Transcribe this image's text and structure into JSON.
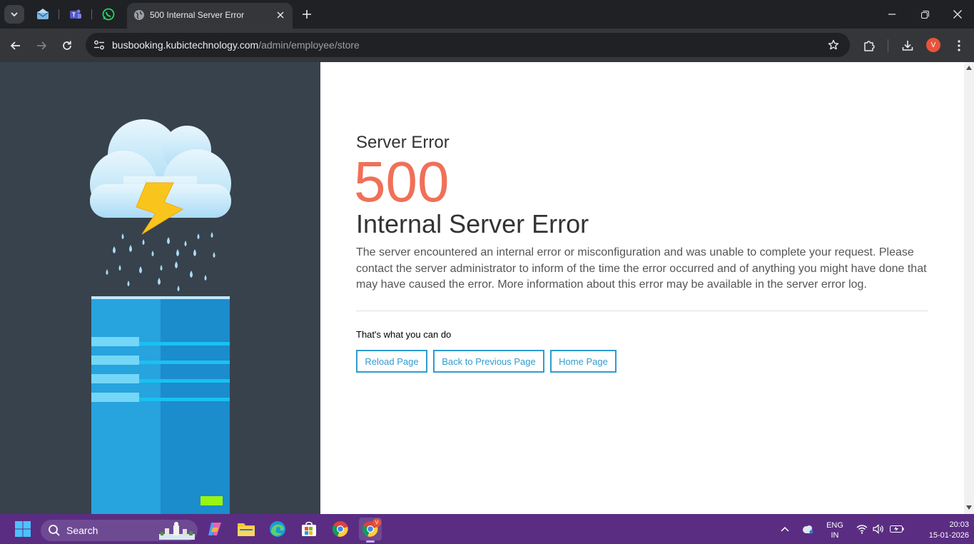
{
  "browser": {
    "tab": {
      "title": "500 Internal Server Error"
    },
    "url": {
      "host": "busbooking.kubictechnology.com",
      "path": "/admin/employee/store"
    },
    "profile_initial": "V"
  },
  "page": {
    "heading_small": "Server Error",
    "code": "500",
    "title": "Internal Server Error",
    "description": "The server encountered an internal error or misconfiguration and was unable to complete your request. Please contact the server administrator to inform of the time the error occurred and of anything you might have done that may have caused the error. More information about this error may be available in the server error log.",
    "actions_label": "That's what you can do",
    "buttons": {
      "reload": "Reload Page",
      "back": "Back to Previous Page",
      "home": "Home Page"
    }
  },
  "taskbar": {
    "search_placeholder": "Search",
    "lang_top": "ENG",
    "lang_bottom": "IN",
    "time": "20:03",
    "date": "15-01-2026",
    "chrome_badge": "V"
  },
  "colors": {
    "accent": "#2f9cd0",
    "error_code": "#f07057",
    "left_panel": "#37424d",
    "taskbar": "#5a2d82"
  }
}
